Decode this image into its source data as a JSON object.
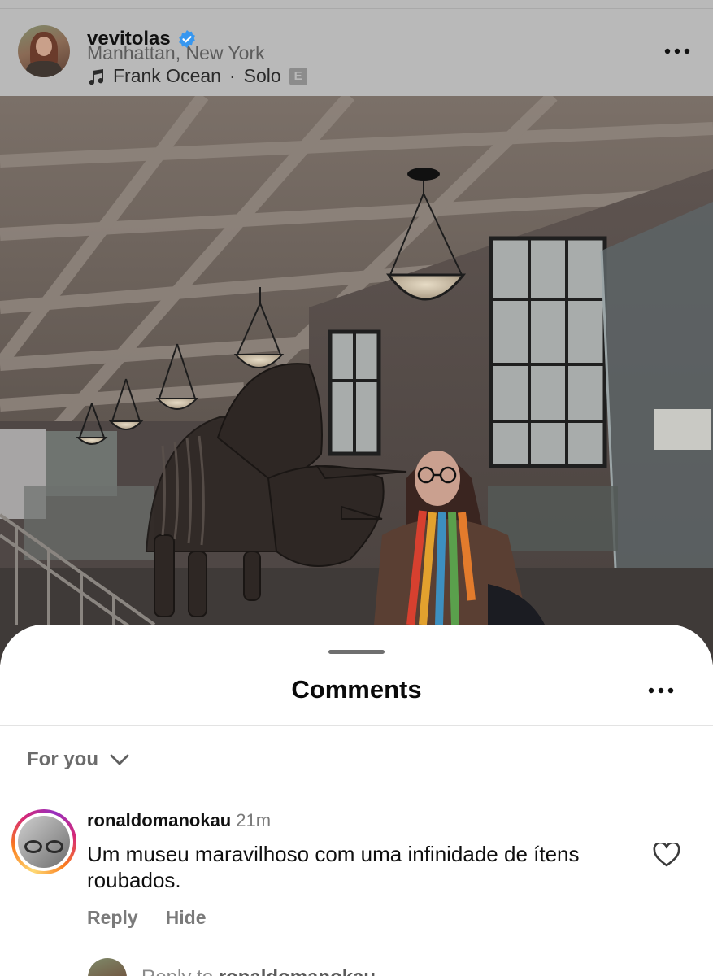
{
  "post": {
    "username": "vevitolas",
    "location": "Manhattan, New York",
    "music_artist": "Frank Ocean",
    "music_separator": "·",
    "music_track": "Solo",
    "explicit_badge": "E"
  },
  "comments_sheet": {
    "title": "Comments",
    "filter_label": "For you",
    "comment": {
      "username": "ronaldomanokau",
      "time": "21m",
      "text": "Um museu maravilhoso com uma infinidade de ítens roubados.",
      "reply_label": "Reply",
      "hide_label": "Hide"
    },
    "reply_prompt_prefix": "Reply to",
    "reply_prompt_handle": "ronaldomanokau"
  },
  "colors": {
    "verified_blue": "#3797f0",
    "story_ring": [
      "#feda75",
      "#fa7e1e",
      "#d62976",
      "#962fbf"
    ]
  },
  "icons": [
    "verified-badge-icon",
    "music-note-icon",
    "more-options-icon",
    "chevron-down-icon",
    "heart-icon"
  ]
}
